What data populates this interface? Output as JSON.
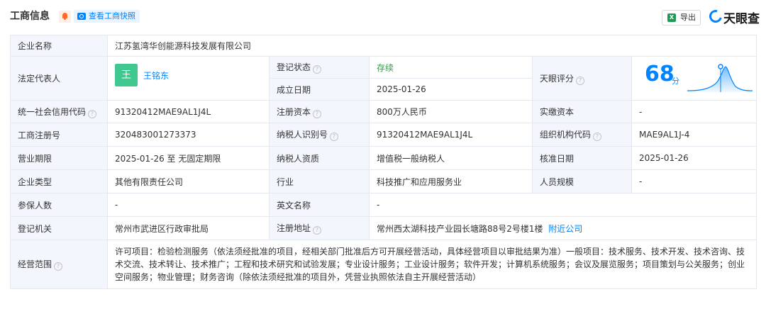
{
  "header": {
    "title": "工商信息",
    "snapshot_label": "查看工商快照",
    "export_label": "导出",
    "brand": "天眼查",
    "accent_color": "#0084ff",
    "bell_color": "#ff6b2a"
  },
  "info": {
    "company_name_label": "企业名称",
    "company_name": "江苏氢湾华创能源科技发展有限公司",
    "legal_rep_label": "法定代表人",
    "legal_rep_avatar": "王",
    "legal_rep_name": "王铭东",
    "reg_status_label": "登记状态",
    "reg_status": "存续",
    "established_label": "成立日期",
    "established": "2025-01-26",
    "rating_label": "天眼评分",
    "score": "68",
    "score_unit": "分",
    "credit_code_label": "统一社会信用代码",
    "credit_code": "91320412MAE9AL1J4L",
    "reg_capital_label": "注册资本",
    "reg_capital": "800万人民币",
    "paid_capital_label": "实缴资本",
    "paid_capital": "-",
    "biz_reg_no_label": "工商注册号",
    "biz_reg_no": "320483001273373",
    "taxpayer_id_label": "纳税人识别号",
    "taxpayer_id": "91320412MAE9AL1J4L",
    "org_code_label": "组织机构代码",
    "org_code": "MAE9AL1J-4",
    "biz_term_label": "营业期限",
    "biz_term": "2025-01-26 至 无固定期限",
    "taxpayer_qual_label": "纳税人资质",
    "taxpayer_qual": "增值税一般纳税人",
    "approval_date_label": "核准日期",
    "approval_date": "2025-01-26",
    "company_type_label": "企业类型",
    "company_type": "其他有限责任公司",
    "industry_label": "行业",
    "industry": "科技推广和应用服务业",
    "staff_size_label": "人员规模",
    "staff_size": "-",
    "insured_label": "参保人数",
    "insured": "-",
    "english_name_label": "英文名称",
    "english_name": "-",
    "reg_authority_label": "登记机关",
    "reg_authority": "常州市武进区行政审批局",
    "reg_address_label": "注册地址",
    "reg_address": "常州西太湖科技产业园长塘路88号2号楼1楼",
    "nearby_label": "附近公司",
    "scope_label": "经营范围",
    "scope": "许可项目：检验检测服务（依法须经批准的项目，经相关部门批准后方可开展经营活动，具体经营项目以审批结果为准）一般项目：技术服务、技术开发、技术咨询、技术交流、技术转让、技术推广；工程和技术研究和试验发展；专业设计服务；工业设计服务；软件开发；计算机系统服务；会议及展览服务；项目策划与公关服务；创业空间服务；物业管理；财务咨询（除依法须经批准的项目外，凭营业执照依法自主开展经营活动）"
  }
}
